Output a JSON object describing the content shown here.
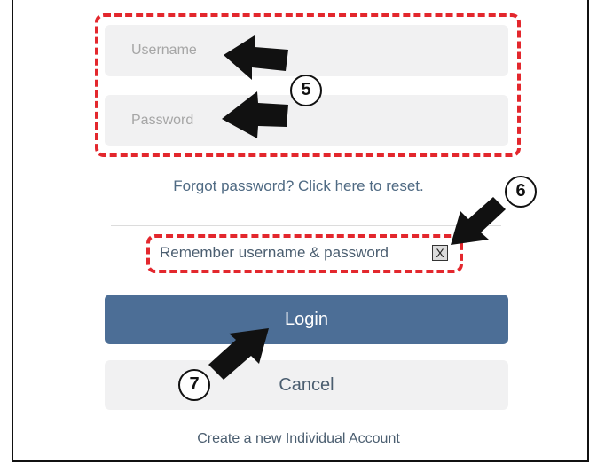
{
  "form": {
    "username_placeholder": "Username",
    "password_placeholder": "Password",
    "forgot_link": "Forgot password? Click here to reset.",
    "remember_label": "Remember username & password",
    "remember_checkbox_mark": "X",
    "login_label": "Login",
    "cancel_label": "Cancel",
    "create_account_link": "Create a new Individual Account"
  },
  "callouts": {
    "step5": "5",
    "step6": "6",
    "step7": "7"
  },
  "colors": {
    "highlight": "#e3272d",
    "login_button": "#4c6e96",
    "input_bg": "#f1f1f2",
    "link_text": "#4f6a83"
  }
}
